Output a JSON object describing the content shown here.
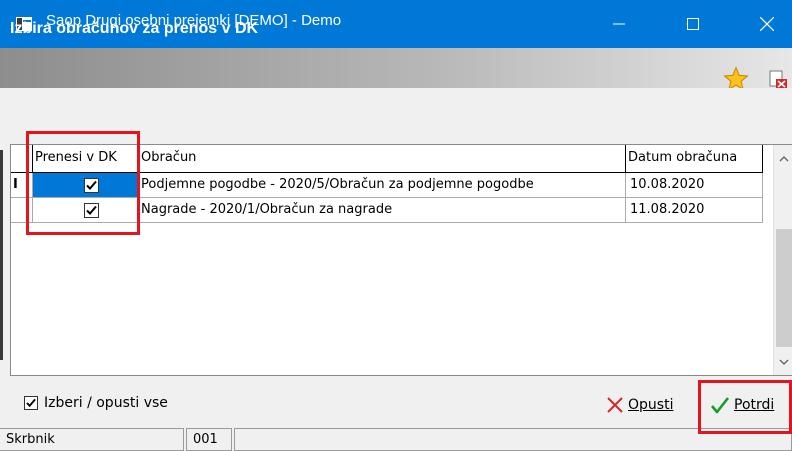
{
  "window": {
    "title": "Saop Drugi osebni prejemki  [DEMO] - Demo",
    "accent_color": "#0078d7",
    "controls": [
      "minimize-icon",
      "maximize-icon",
      "close-icon"
    ]
  },
  "form": {
    "title": "Izbira obračunov za prenos v DK",
    "icons": [
      "favorite-star-icon",
      "close-form-icon"
    ]
  },
  "grid": {
    "columns": [
      "",
      "Prenesi v DK",
      "Obračun",
      "Datum obračuna"
    ],
    "rows": [
      {
        "indicator": "I",
        "transfer": true,
        "obracun": "Podjemne pogodbe - 2020/5/Obračun za podjemne pogodbe",
        "datum": "10.08.2020"
      },
      {
        "indicator": "",
        "transfer": true,
        "obracun": "Nagrade - 2020/1/Obračun za nagrade",
        "datum": "11.08.2020"
      }
    ],
    "selected_color": "#0078d7"
  },
  "footer": {
    "select_all_label": "Izberi / opusti vse",
    "select_all_checked": true,
    "cancel_label": "Opusti",
    "confirm_label": "Potrdi"
  },
  "status": {
    "label": "Skrbnik",
    "value": "001"
  },
  "annotation_color": "#e3141e"
}
